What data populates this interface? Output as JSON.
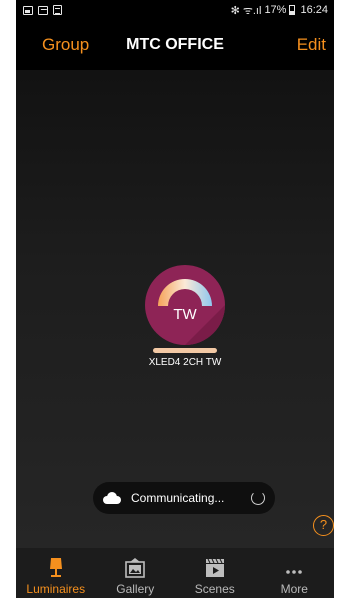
{
  "status_bar": {
    "bluetooth": "✻",
    "signal": "ᯤ.ıl",
    "battery": "17%",
    "time": "16:24"
  },
  "header": {
    "left_button": "Group",
    "title": "MTC OFFICE",
    "right_button": "Edit"
  },
  "luminaire": {
    "code": "TW",
    "name": "XLED4 2CH TW"
  },
  "toast": {
    "text": "Communicating..."
  },
  "help": {
    "label": "?"
  },
  "tabs": [
    {
      "label": "Luminaires",
      "icon": "lamp-icon",
      "active": true
    },
    {
      "label": "Gallery",
      "icon": "gallery-icon",
      "active": false
    },
    {
      "label": "Scenes",
      "icon": "scenes-icon",
      "active": false
    },
    {
      "label": "More",
      "icon": "more-icon",
      "active": false
    }
  ],
  "colors": {
    "accent": "#f5901e",
    "luminaire": "#8e2456"
  }
}
